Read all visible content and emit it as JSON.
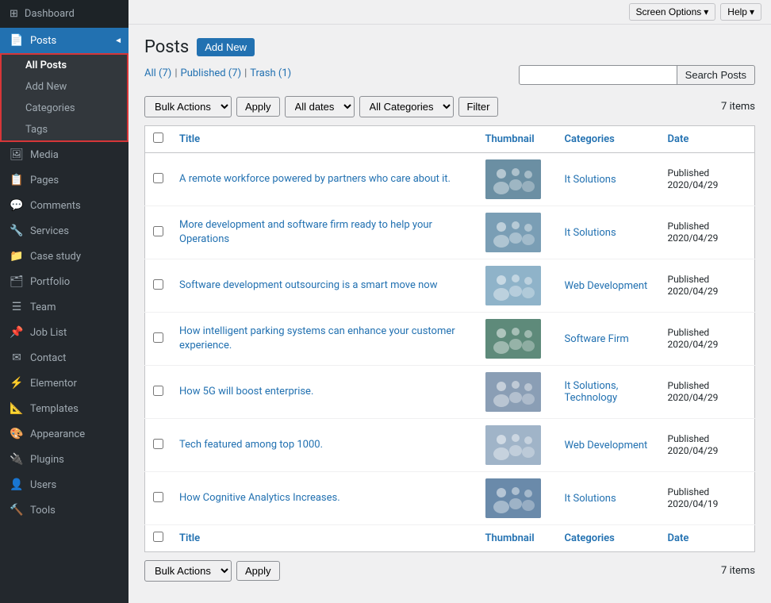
{
  "topbar": {
    "screen_options": "Screen Options",
    "help": "Help"
  },
  "sidebar": {
    "brand": "Dashboard",
    "items": [
      {
        "id": "dashboard",
        "label": "Dashboard",
        "icon": "⊞"
      },
      {
        "id": "posts",
        "label": "Posts",
        "icon": "📄",
        "active": true,
        "arrow": "◄",
        "subitems": [
          {
            "id": "all-posts",
            "label": "All Posts",
            "active": true
          },
          {
            "id": "add-new",
            "label": "Add New"
          },
          {
            "id": "categories",
            "label": "Categories"
          },
          {
            "id": "tags",
            "label": "Tags"
          }
        ]
      },
      {
        "id": "media",
        "label": "Media",
        "icon": "🖼"
      },
      {
        "id": "pages",
        "label": "Pages",
        "icon": "📋"
      },
      {
        "id": "comments",
        "label": "Comments",
        "icon": "💬"
      },
      {
        "id": "services",
        "label": "Services",
        "icon": "🔧"
      },
      {
        "id": "case-study",
        "label": "Case study",
        "icon": "📁"
      },
      {
        "id": "portfolio",
        "label": "Portfolio",
        "icon": "🗂"
      },
      {
        "id": "team",
        "label": "Team",
        "icon": "☰"
      },
      {
        "id": "job-list",
        "label": "Job List",
        "icon": "📌"
      },
      {
        "id": "contact",
        "label": "Contact",
        "icon": "✉"
      },
      {
        "id": "elementor",
        "label": "Elementor",
        "icon": "⚡"
      },
      {
        "id": "templates",
        "label": "Templates",
        "icon": "📐"
      },
      {
        "id": "appearance",
        "label": "Appearance",
        "icon": "🎨"
      },
      {
        "id": "plugins",
        "label": "Plugins",
        "icon": "🔌"
      },
      {
        "id": "users",
        "label": "Users",
        "icon": "👤"
      },
      {
        "id": "tools",
        "label": "Tools",
        "icon": "🔨"
      }
    ]
  },
  "page": {
    "title": "Posts",
    "add_new": "Add New",
    "filter_links": [
      {
        "label": "All",
        "count": 7,
        "active": true
      },
      {
        "label": "Published",
        "count": 7
      },
      {
        "label": "Trash",
        "count": 1
      }
    ],
    "bulk_actions": "Bulk Actions",
    "apply": "Apply",
    "all_dates": "All dates",
    "all_categories": "All Categories",
    "filter": "Filter",
    "items_count": "7 items",
    "search_placeholder": "",
    "search_btn": "Search Posts",
    "columns": {
      "title": "Title",
      "thumbnail": "Thumbnail",
      "categories": "Categories",
      "date": "Date"
    },
    "posts": [
      {
        "id": 1,
        "title": "A remote workforce powered by partners who care about it.",
        "category": "It Solutions",
        "status": "Published",
        "date": "2020/04/29",
        "thumb_color": "#6b8fa3"
      },
      {
        "id": 2,
        "title": "More development and software firm ready to help your Operations",
        "category": "It Solutions",
        "status": "Published",
        "date": "2020/04/29",
        "thumb_color": "#7a9eb5"
      },
      {
        "id": 3,
        "title": "Software development outsourcing is a smart move now",
        "category": "Web Development",
        "status": "Published",
        "date": "2020/04/29",
        "thumb_color": "#8fb3c9"
      },
      {
        "id": 4,
        "title": "How intelligent parking systems can enhance your customer experience.",
        "category": "Software Firm",
        "status": "Published",
        "date": "2020/04/29",
        "thumb_color": "#5e8a7a"
      },
      {
        "id": 5,
        "title": "How 5G will boost enterprise.",
        "category": "It Solutions, Technology",
        "status": "Published",
        "date": "2020/04/29",
        "thumb_color": "#8a9eb5"
      },
      {
        "id": 6,
        "title": "Tech featured among top 1000.",
        "category": "Web Development",
        "status": "Published",
        "date": "2020/04/29",
        "thumb_color": "#a0b4c8"
      },
      {
        "id": 7,
        "title": "How Cognitive Analytics Increases.",
        "category": "It Solutions",
        "status": "Published",
        "date": "2020/04/19",
        "thumb_color": "#6a8aaa"
      }
    ]
  }
}
